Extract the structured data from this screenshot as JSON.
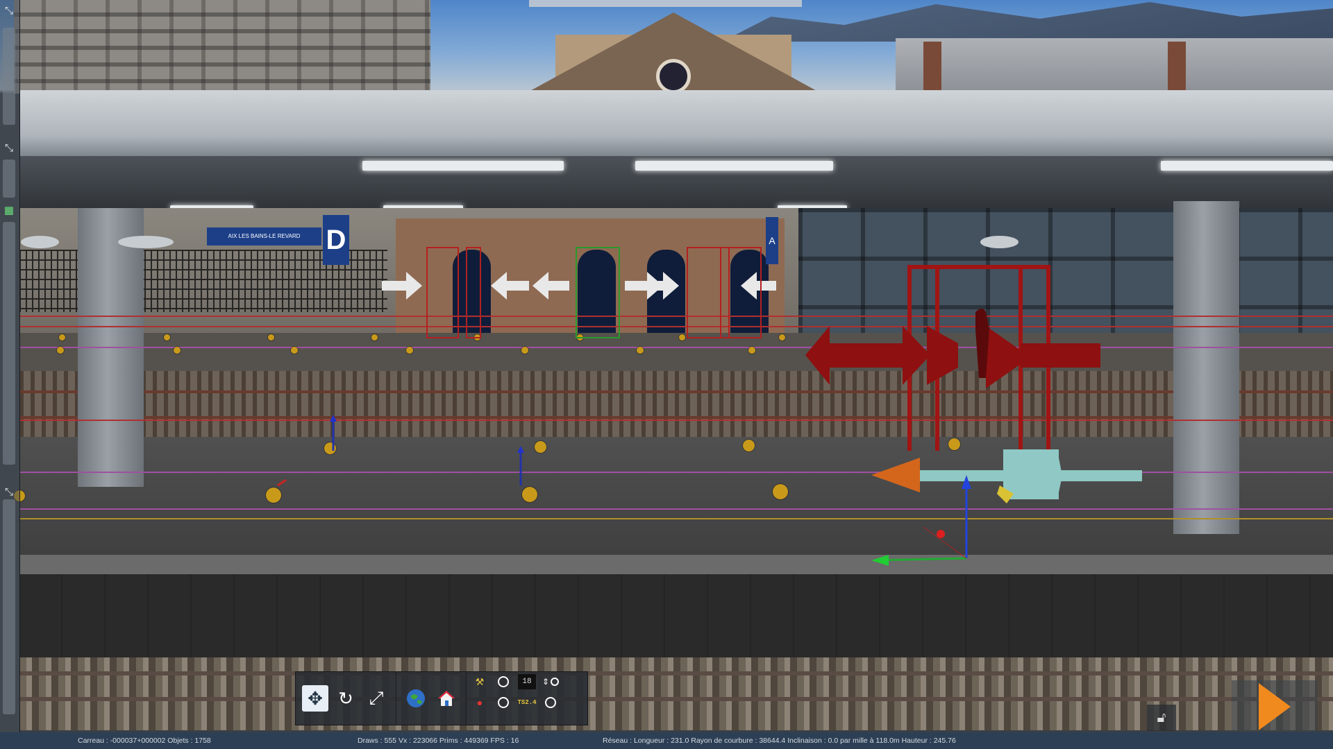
{
  "scene": {
    "station_sign_label": "AIX LES BAINS-LE REVARD",
    "platform_letter_d": "D",
    "platform_letter_a": "A"
  },
  "left_rail": {
    "tabs": [
      {
        "icon": "collapse-icon"
      },
      {
        "icon": "collapse-icon"
      },
      {
        "icon": "grid-panel-icon"
      },
      {
        "icon": "collapse-icon"
      }
    ]
  },
  "toolbar": {
    "tools": [
      {
        "name": "move-tool",
        "icon": "move-arrows-icon",
        "active": true
      },
      {
        "name": "rotate-tool",
        "icon": "rotate-icon",
        "active": false
      },
      {
        "name": "scale-tool",
        "icon": "scale-icon",
        "active": false
      }
    ],
    "view_buttons": [
      {
        "name": "world-view",
        "icon": "globe-icon"
      },
      {
        "name": "home-view",
        "icon": "home-icon"
      }
    ],
    "options": {
      "counter_value": "18",
      "ts_label": "TS2.4"
    }
  },
  "right_controls": {
    "lock_icon": "unlock-icon",
    "play_icon": "play-icon",
    "play_color": "#f08a1e"
  },
  "status_bar": {
    "tile_info": "Carreau : -000037+000002  Objets : 1758",
    "render_info": "Draws : 555 Vx : 223066 Prims : 449369 FPS : 16",
    "network_info": "Réseau :  Longueur : 231.0 Rayon de courbure : 38644.4 Inclinaison : 0.0 par mille à 118.0m Hauteur : 245.76"
  },
  "colors": {
    "status_bar_bg": "#2c3f55",
    "marker_yellow": "#c99a1a",
    "selection_red": "#a01414",
    "gizmo_cyan": "#8fc8c4",
    "gizmo_orange": "#d4661c"
  }
}
